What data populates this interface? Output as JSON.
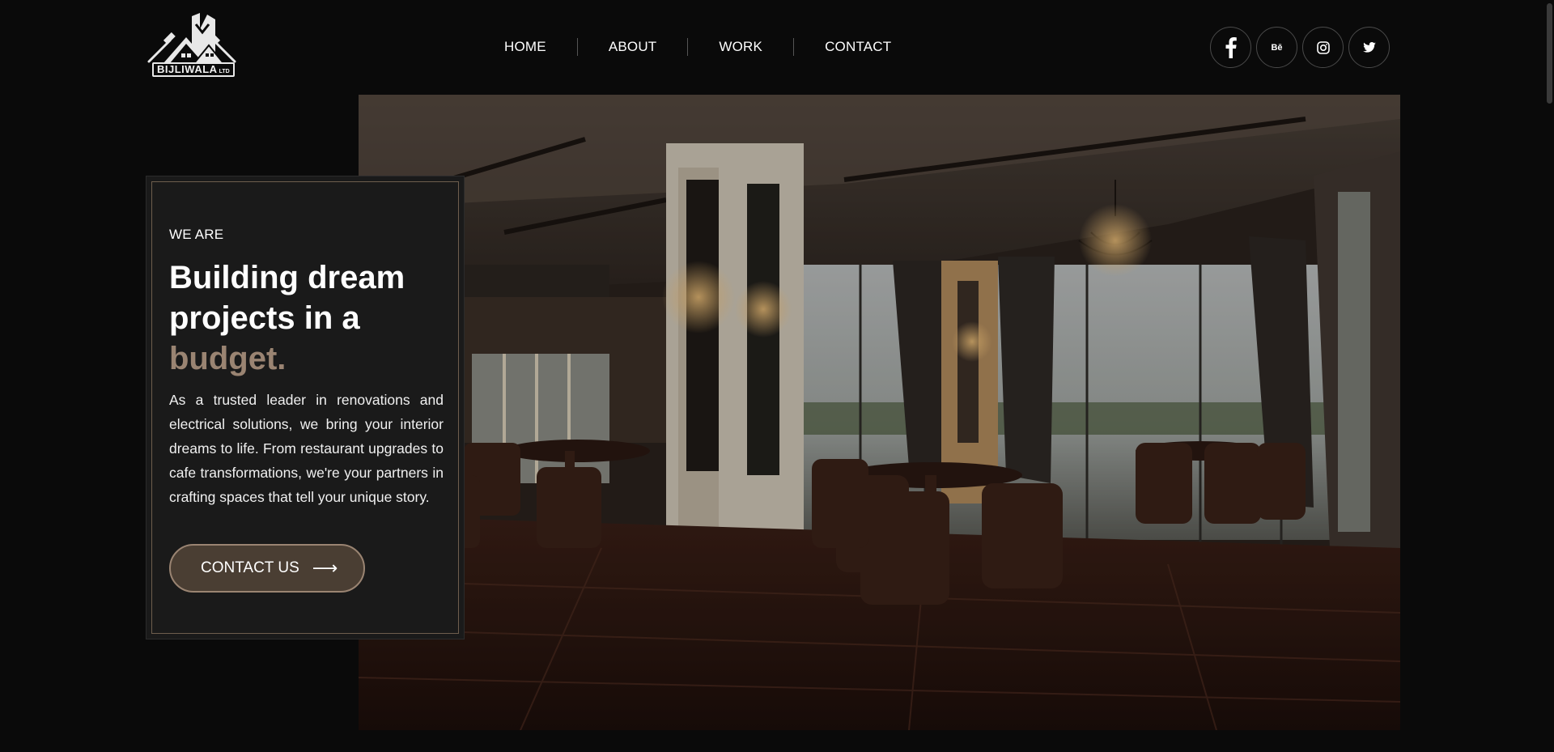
{
  "brand": {
    "name": "BIJLIWALA",
    "suffix": "LTD",
    "icon": "house-with-tools-logo-icon"
  },
  "nav": {
    "items": [
      {
        "label": "HOME"
      },
      {
        "label": "ABOUT"
      },
      {
        "label": "WORK"
      },
      {
        "label": "CONTACT"
      }
    ]
  },
  "socials": {
    "facebook_icon": "facebook-icon",
    "behance_label": "Bē",
    "instagram_icon": "instagram-icon",
    "twitter_icon": "twitter-icon"
  },
  "hero": {
    "kicker": "WE ARE",
    "title_line1": "Building dream",
    "title_line2": "projects in a",
    "title_accent": "budget.",
    "description": "As a trusted leader in renovations and electrical solutions, we bring your interior dreams to life. From restaurant upgrades to cafe transformations, we're your partners in crafting spaces that tell your unique story.",
    "cta_label": "CONTACT US",
    "cta_arrow": "⟶",
    "image_subject": "dimly-lit-restaurant-interior-image"
  },
  "colors": {
    "background": "#0a0a0a",
    "card": "#1a1a1a",
    "accent": "#9a8472",
    "button": "#4a3e33"
  }
}
